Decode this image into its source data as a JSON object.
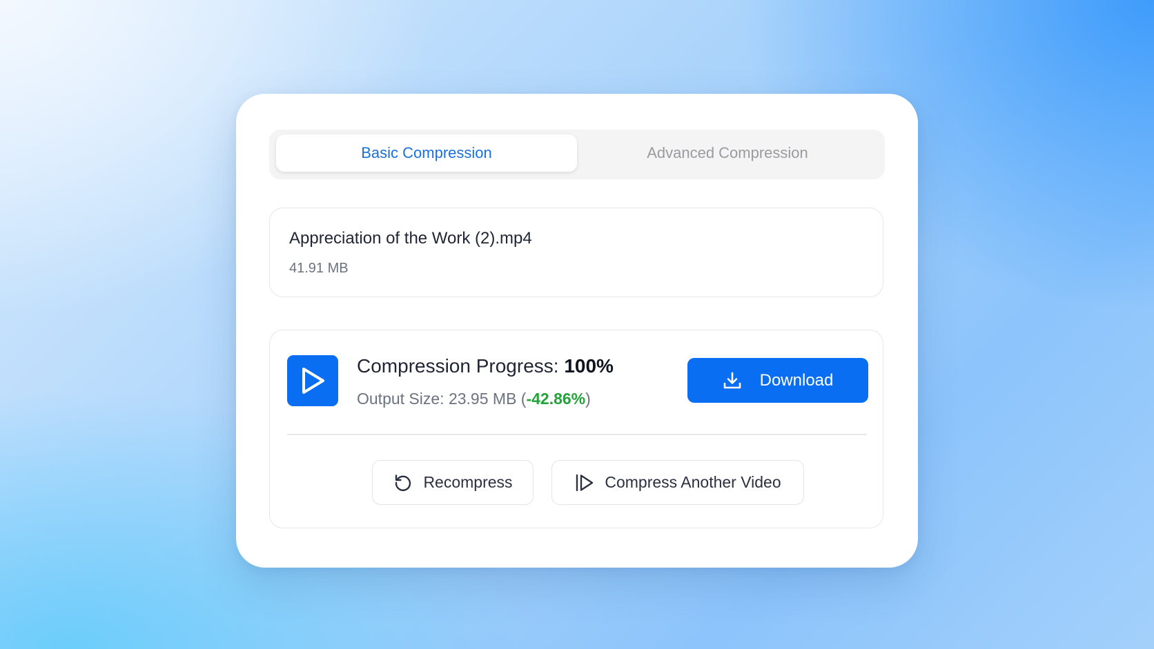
{
  "tabs": [
    {
      "label": "Basic Compression",
      "active": true
    },
    {
      "label": "Advanced Compression",
      "active": false
    }
  ],
  "file": {
    "name": "Appreciation of the Work (2).mp4",
    "size": "41.91 MB"
  },
  "progress": {
    "label": "Compression Progress: ",
    "value": "100%",
    "output_label": "Output Size: 23.95 MB (",
    "output_change": "-42.86%",
    "output_suffix": ")",
    "icon": "play-icon"
  },
  "actions": {
    "download_label": "Download",
    "download_icon": "download-icon",
    "recompress_label": "Recompress",
    "recompress_icon": "refresh-icon",
    "another_label": "Compress Another Video",
    "another_icon": "skip-play-icon"
  },
  "colors": {
    "accent": "#0a6ef2",
    "tab_active_text": "#1a6fde",
    "reduction_green": "#22a33a"
  }
}
